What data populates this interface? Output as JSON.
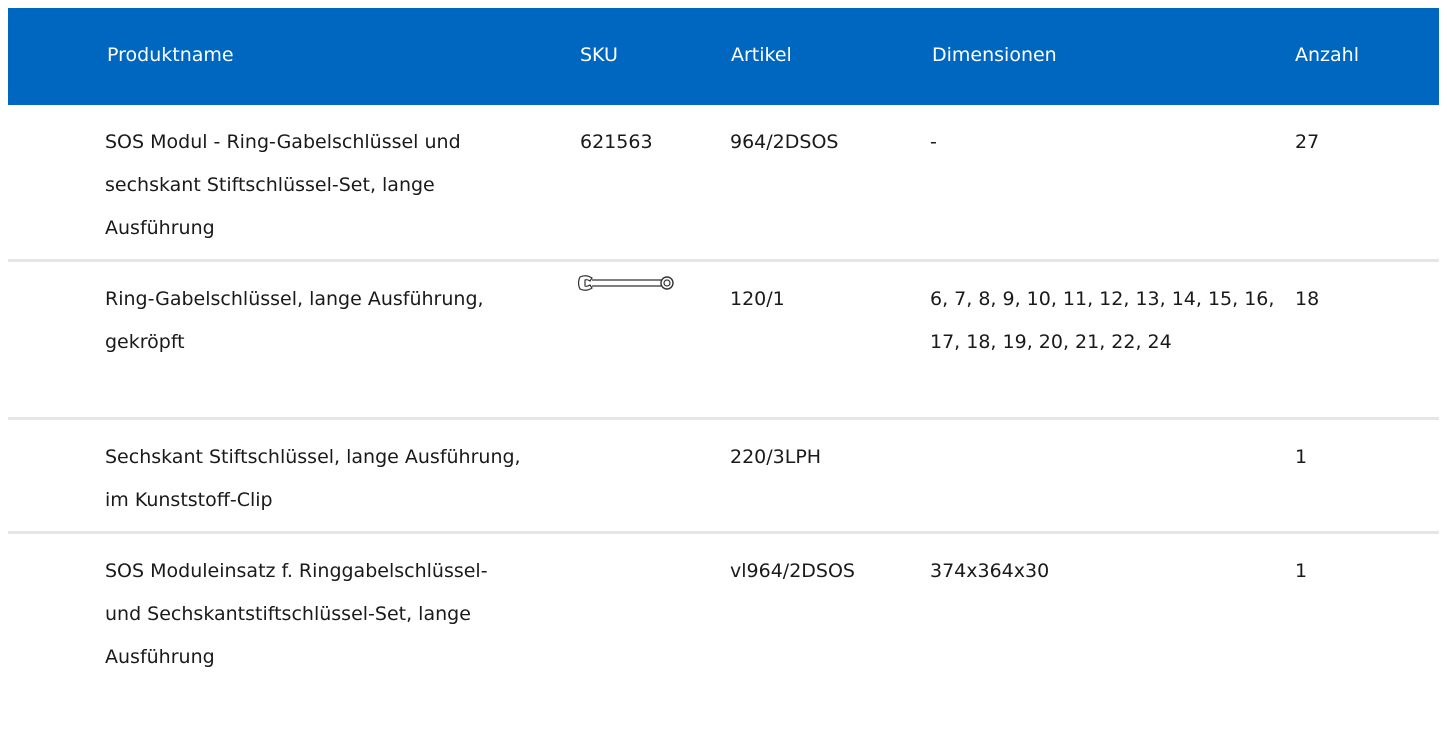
{
  "table": {
    "headers": {
      "name": "Produktname",
      "sku": "SKU",
      "article": "Artikel",
      "dimensions": "Dimensionen",
      "quantity": "Anzahl"
    },
    "rows": [
      {
        "name": "SOS Modul - Ring-Gabelschlüssel und sechskant Stiftschlüssel-Set, lange Ausführung",
        "sku": "621563",
        "article": "964/2DSOS",
        "dimensions": "-",
        "quantity": "27"
      },
      {
        "name": "Ring-Gabelschlüssel, lange Ausführung, gekröpft",
        "sku_icon": "combination-wrench-icon",
        "article": "120/1",
        "dimensions": "6, 7, 8, 9, 10, 11, 12, 13, 14, 15, 16, 17, 18, 19, 20, 21, 22, 24",
        "quantity": "18"
      },
      {
        "name": "Sechskant Stiftschlüssel, lange Ausführung, im Kunststoff-Clip",
        "article": "220/3LPH",
        "dimensions": "",
        "quantity": "1"
      },
      {
        "name": "SOS Moduleinsatz f. Ringgabelschlüssel- und Sechskantstiftschlüssel-Set, lange Ausführung",
        "article": "vl964/2DSOS",
        "dimensions": "374x364x30",
        "quantity": "1"
      }
    ]
  },
  "colors": {
    "header_bg": "#0067c0",
    "header_text": "#ffffff",
    "row_divider": "#e4e6e8"
  }
}
